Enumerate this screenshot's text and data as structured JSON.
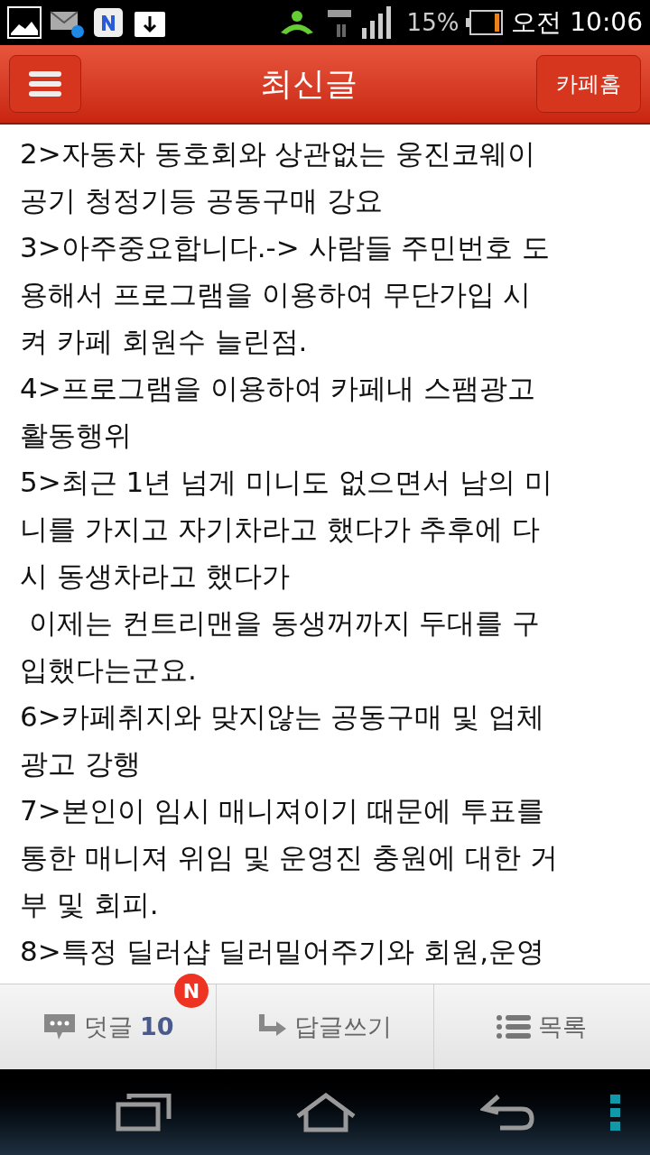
{
  "status_bar": {
    "battery": "15%",
    "time": "오전 10:06"
  },
  "header": {
    "title": "최신글",
    "home_button": "카페홈"
  },
  "body_lines": [
    "2>자동차 동호회와 상관없는 웅진코웨이",
    "공기 청정기등 공동구매 강요",
    "3>아주중요합니다.-> 사람들 주민번호 도",
    "용해서 프로그램을 이용하여 무단가입 시",
    "켜 카페 회원수 늘린점.",
    "4>프로그램을 이용하여 카페내 스팸광고",
    "활동행위",
    "5>최근 1년 넘게 미니도 없으면서 남의 미",
    "니를 가지고 자기차라고 했다가 추후에 다",
    "시 동생차라고 했다가",
    " 이제는 컨트리맨을 동생꺼까지 두대를 구",
    "입했다는군요.",
    "6>카페취지와 맞지않는 공동구매 및 업체",
    "광고 강행",
    "7>본인이 임시 매니져이기 때문에 투표를",
    "통한 매니져 위임 및 운영진 충원에 대한 거",
    "부 및 회피.",
    "8>특정 딜러샵 딜러밀어주기와 회원,운영"
  ],
  "bottom_bar": {
    "comments": {
      "label": "덧글",
      "count": "10",
      "badge": "N"
    },
    "reply": "답글쓰기",
    "list": "목록"
  }
}
